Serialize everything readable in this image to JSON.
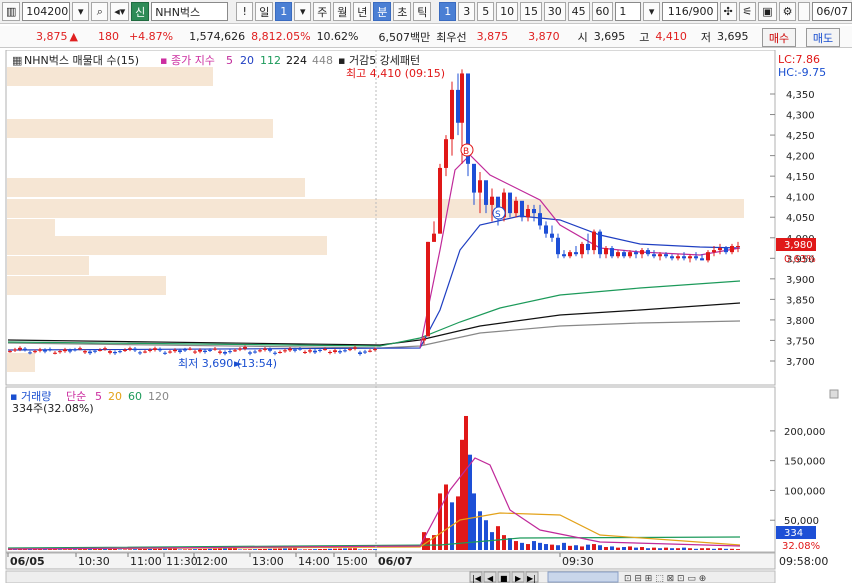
{
  "toolbar": {
    "code": "104200",
    "badge": "신",
    "name": "NHN벅스",
    "excl": "!",
    "periods": [
      "일",
      "1",
      "주",
      "월",
      "년",
      "분",
      "초",
      "틱"
    ],
    "minutes": [
      "1",
      "3",
      "5",
      "10",
      "15",
      "30",
      "45",
      "60"
    ],
    "count": "1",
    "page": "116/900",
    "date": "06/07"
  },
  "quote": {
    "price": "3,875",
    "change": "180",
    "rate": "+4.87%",
    "volume": "1,574,626",
    "vol_rate": "8,812.05%",
    "turnover": "10.62%",
    "amount": "6,507백만",
    "best_label": "최우선",
    "ask": "3,875",
    "bid": "3,870",
    "open_label": "시",
    "open": "3,695",
    "high_label": "고",
    "high": "4,410",
    "low_label": "저",
    "low": "3,695",
    "buy": "매수",
    "sell": "매도"
  },
  "price_panel": {
    "legend_title": "NHN벅스 매물대 수(15)",
    "ma_label": "종가 지수",
    "ma_periods": [
      "5",
      "20",
      "112",
      "224",
      "448"
    ],
    "pattern_label": "거감5 강세패턴",
    "high_annot": "최고 4,410 (09:15)",
    "low_annot": "최저 3,690 (13:54)",
    "lc": "LC:7.86",
    "hc": "HC:-9.75",
    "axis": [
      "4,350",
      "4,300",
      "4,250",
      "4,200",
      "4,150",
      "4,100",
      "4,050",
      "4,000",
      "3,950",
      "3,900",
      "3,850",
      "3,800",
      "3,750",
      "3,700"
    ],
    "current_price": "3,980",
    "current_rate": "0.63%",
    "marker_b": "B",
    "marker_s": "S"
  },
  "volume_panel": {
    "legend_title": "거래량",
    "ma_label": "단순",
    "ma_periods": [
      "5",
      "20",
      "60",
      "120"
    ],
    "sub": "334주(32.08%)",
    "axis": [
      "200,000",
      "150,000",
      "100,000",
      "50,000"
    ],
    "current": "334",
    "current_rate": "32.08%"
  },
  "time_axis": {
    "labels": [
      "06/05",
      "10:30",
      "11:00",
      "11:30",
      "12:00",
      "13:00",
      "14:00",
      "15:00",
      "06/07",
      "09:30"
    ],
    "clock": "09:58:00"
  },
  "colors": {
    "up": "#e01818",
    "down": "#1d4fd6",
    "accent": "#4a7fd4"
  }
}
